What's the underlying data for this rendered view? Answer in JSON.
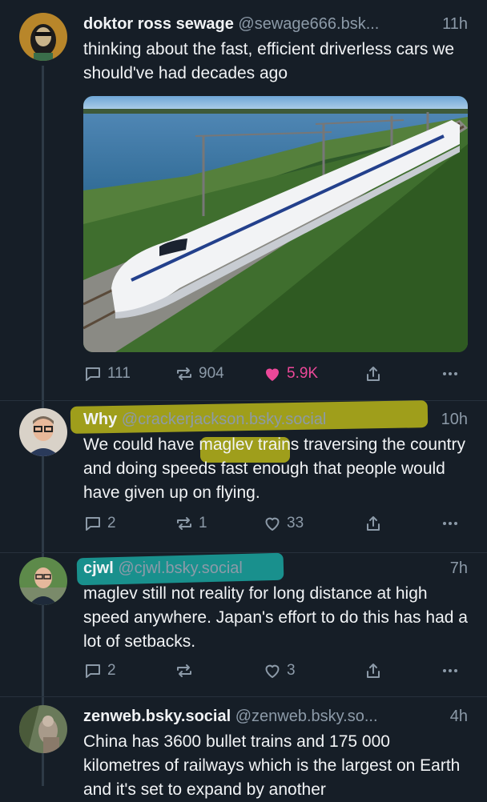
{
  "posts": [
    {
      "name": "doktor ross sewage",
      "handle": "@sewage666.bsk...",
      "time": "11h",
      "text": "thinking about the fast, efficient driverless cars we should've had decades ago",
      "counts": {
        "replies": "111",
        "reposts": "904",
        "likes": "5.9K"
      },
      "liked": true
    },
    {
      "name": "Why",
      "handle": "@crackerjackson.bsky.social",
      "time": "10h",
      "text": "We could have maglev trains traversing the country and doing speeds fast enough that people would have given up on flying.",
      "counts": {
        "replies": "2",
        "reposts": "1",
        "likes": "33"
      },
      "highlight_color": "#b7b51a"
    },
    {
      "name": "cjwl",
      "handle": "@cjwl.bsky.social",
      "time": "7h",
      "text": "maglev still not reality for long distance at high speed anywhere. Japan's effort to do this has had a lot of setbacks.",
      "counts": {
        "replies": "2",
        "reposts": "",
        "likes": "3"
      },
      "highlight_color": "#1aa5a0"
    },
    {
      "name": "zenweb.bsky.social",
      "handle": "@zenweb.bsky.so...",
      "time": "4h",
      "text": "China has 3600 bullet trains and 175 000 kilometres of railways which is the largest on Earth and it's set to expand by another"
    }
  ],
  "colors": {
    "background": "#161e27",
    "like": "#ec4899",
    "muted": "#8c9aa8"
  }
}
